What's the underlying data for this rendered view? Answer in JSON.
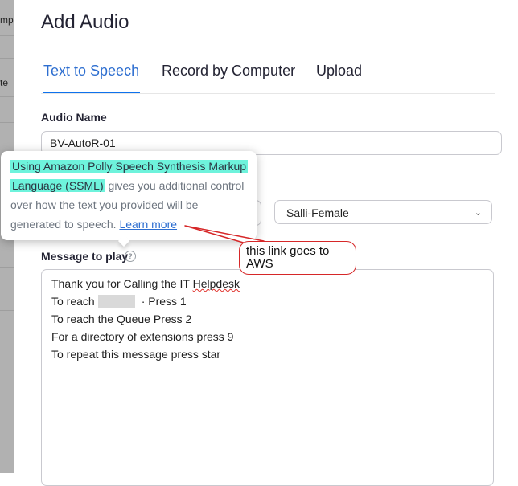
{
  "background": {
    "fragment_1": "mp",
    "fragment_2": "te"
  },
  "dialog": {
    "title": "Add Audio",
    "tabs": [
      {
        "label": "Text to Speech",
        "active": true
      },
      {
        "label": "Record by Computer",
        "active": false
      },
      {
        "label": "Upload",
        "active": false
      }
    ],
    "audio_name": {
      "label": "Audio Name",
      "value": "BV-AutoR-01"
    },
    "voice": {
      "selected": "Salli-Female"
    },
    "message": {
      "label": "Message to play",
      "lines": [
        {
          "before": "Thank you for Calling the IT ",
          "misspelled": "Helpdesk"
        },
        {
          "before": "To reach",
          "after": "· Press 1"
        },
        {
          "text": "To reach the Queue Press 2"
        },
        {
          "text": "For a directory of extensions press 9"
        },
        {
          "text": "To repeat this message press star"
        }
      ]
    }
  },
  "tooltip": {
    "highlight_line_1": "Using Amazon Polly Speech Synthesis Markup",
    "highlight_line_2": "Language (SSML)",
    "line_2_rest": " gives you additional control",
    "line_3": "over how the text you provided will be",
    "line_4": "generated to speech. ",
    "learn_more": "Learn more"
  },
  "annotation": {
    "text": "this link goes to AWS",
    "color": "#d62728"
  },
  "colors": {
    "accent": "#0e72ed",
    "highlight": "#6ef3dc"
  }
}
